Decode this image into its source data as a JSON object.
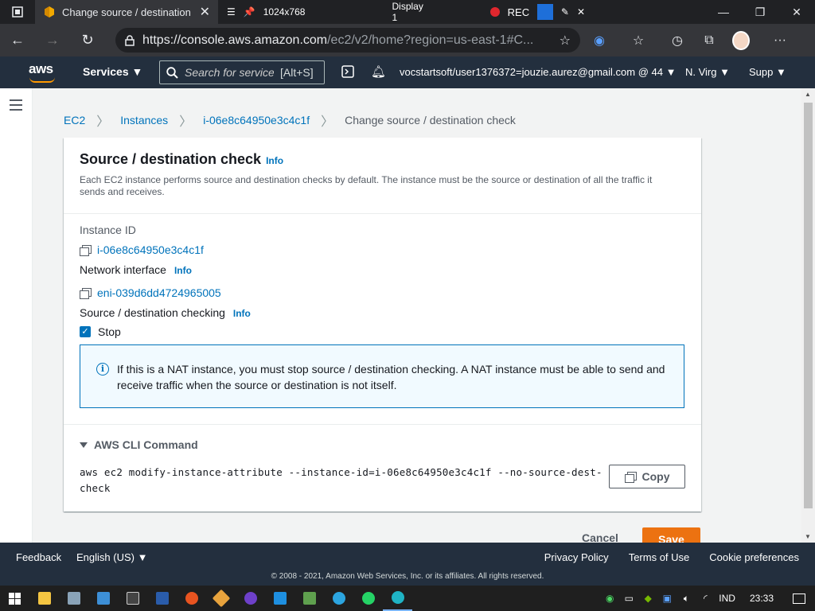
{
  "browser": {
    "tab_title": "Change source / destination check",
    "recorder": {
      "resolution": "1024x768",
      "display": "Display 1",
      "rec_label": "REC"
    },
    "url_main": "https://console.aws.amazon.com",
    "url_rest": "/ec2/v2/home?region=us-east-1#C..."
  },
  "aws_header": {
    "services_label": "Services ▼",
    "search_placeholder": "Search for service",
    "search_shortcut": "[Alt+S]",
    "account": "vocstartsoft/user1376372=jouzie.aurez@gmail.com @ 44 ▼",
    "region": "N. Virg ▼",
    "support": "Supp ▼"
  },
  "breadcrumb": {
    "ec2": "EC2",
    "instances": "Instances",
    "instance_id": "i-06e8c64950e3c4c1f",
    "current": "Change source / destination check"
  },
  "panel": {
    "title": "Source / destination check",
    "info": "Info",
    "description": "Each EC2 instance performs source and destination checks by default. The instance must be the source or destination of all the traffic it sends and receives.",
    "instance_id_label": "Instance ID",
    "instance_id_value": "i-06e8c64950e3c4c1f",
    "network_interface_label": "Network interface",
    "network_interface_value": "eni-039d6dd4724965005",
    "checking_label": "Source / destination checking",
    "stop_label": "Stop",
    "stop_checked": true,
    "alert_text": "If this is a NAT instance, you must stop source / destination checking. A NAT instance must be able to send and receive traffic when the source or destination is not itself."
  },
  "cli": {
    "header": "AWS CLI Command",
    "command": "aws ec2 modify-instance-attribute --instance-id=i-06e8c64950e3c4c1f --no-source-dest-check",
    "copy_label": "Copy"
  },
  "actions": {
    "cancel": "Cancel",
    "save": "Save"
  },
  "footer": {
    "feedback": "Feedback",
    "language": "English (US) ▼",
    "privacy": "Privacy Policy",
    "terms": "Terms of Use",
    "cookies": "Cookie preferences",
    "copyright": "© 2008 - 2021, Amazon Web Services, Inc. or its affiliates. All rights reserved."
  },
  "taskbar": {
    "lang": "IND",
    "time": "23:33"
  },
  "colors": {
    "aws_nav": "#232f3e",
    "aws_orange": "#ec7211",
    "link_blue": "#0073bb",
    "info_bg": "#f1faff"
  }
}
